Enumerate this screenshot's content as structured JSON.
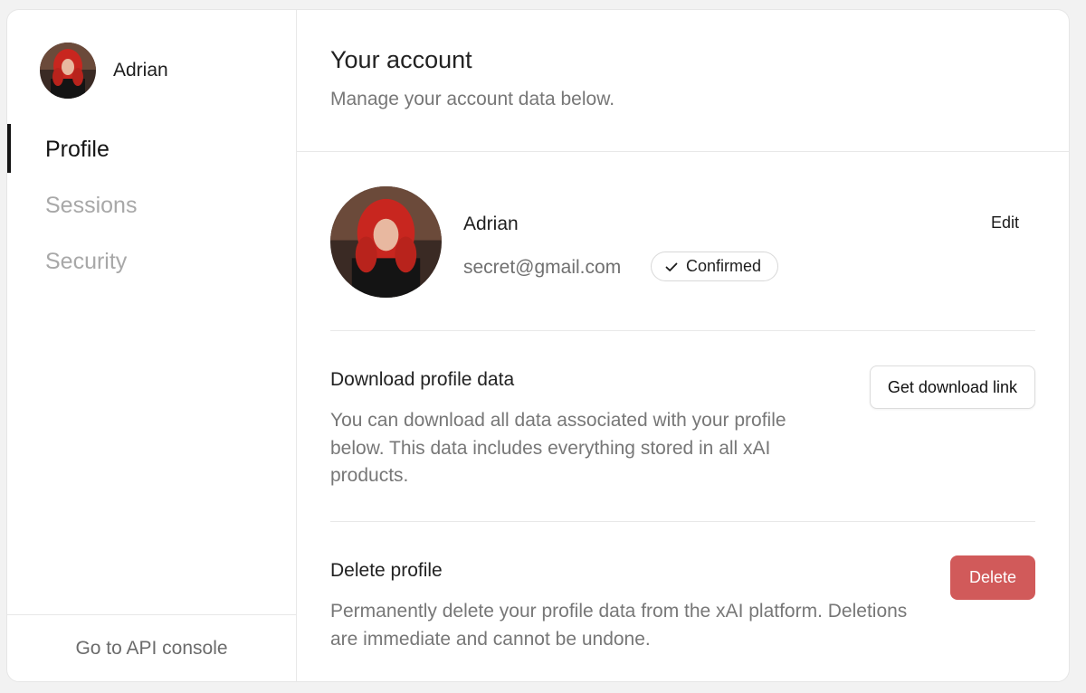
{
  "sidebar": {
    "user_name": "Adrian",
    "items": [
      {
        "label": "Profile",
        "active": true
      },
      {
        "label": "Sessions",
        "active": false
      },
      {
        "label": "Security",
        "active": false
      }
    ],
    "footer_link": "Go to API console"
  },
  "header": {
    "title": "Your account",
    "subtitle": "Manage your account data below."
  },
  "profile": {
    "name": "Adrian",
    "email": "secret@gmail.com",
    "badge": "Confirmed",
    "edit_label": "Edit"
  },
  "download": {
    "title": "Download profile data",
    "description": "You can download all data associated with your profile below. This data includes everything stored in all xAI products.",
    "button": "Get download link"
  },
  "delete": {
    "title": "Delete profile",
    "description": "Permanently delete your profile data from the xAI platform. Deletions are immediate and cannot be undone.",
    "button": "Delete"
  },
  "colors": {
    "danger": "#d15a5a",
    "active_nav": "#151515",
    "muted_text": "#777777"
  },
  "icons": {
    "badge": "check-icon"
  }
}
